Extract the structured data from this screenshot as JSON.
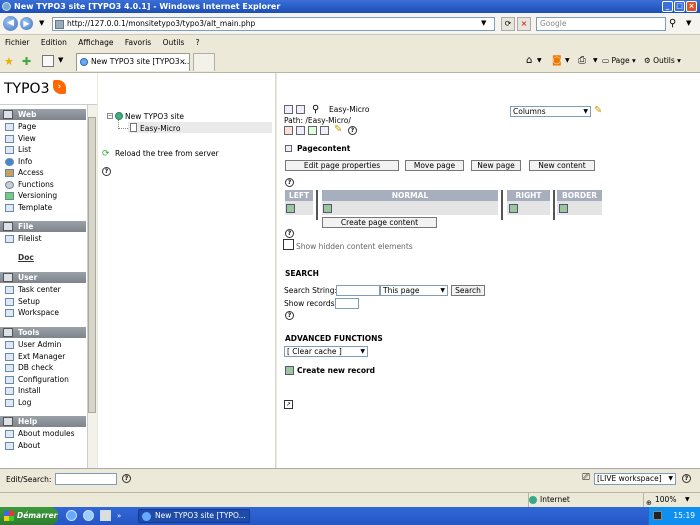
{
  "window": {
    "title": "New TYPO3 site [TYPO3 4.0.1] - Windows Internet Explorer"
  },
  "address": {
    "url": "http://127.0.0.1/monsitetypo3/typo3/alt_main.php",
    "search_placeholder": "Google"
  },
  "menu": [
    "Fichier",
    "Edition",
    "Affichage",
    "Favoris",
    "Outils",
    "?"
  ],
  "tabs": {
    "active": "New TYPO3 site [TYPO3 ..."
  },
  "toolbar": {
    "page": "Page",
    "tools": "Outils"
  },
  "logo": {
    "text": "TYPO3"
  },
  "nav": {
    "web": {
      "title": "Web",
      "items": [
        "Page",
        "View",
        "List",
        "Info",
        "Access",
        "Functions",
        "Versioning",
        "Template"
      ]
    },
    "file": {
      "title": "File",
      "items": [
        "Filelist"
      ]
    },
    "doc": {
      "title": "Doc"
    },
    "user": {
      "title": "User",
      "items": [
        "Task center",
        "Setup",
        "Workspace"
      ]
    },
    "tools": {
      "title": "Tools",
      "items": [
        "User Admin",
        "Ext Manager",
        "DB check",
        "Configuration",
        "Install",
        "Log"
      ]
    },
    "help": {
      "title": "Help",
      "items": [
        "About modules",
        "About"
      ]
    }
  },
  "tree": {
    "root": "New TYPO3 site",
    "child": "Easy-Micro",
    "reload": "Reload the tree from server"
  },
  "page": {
    "name": "Easy-Micro",
    "path": "Path: /Easy-Micro/",
    "columns_select": "Columns",
    "section": "Pagecontent",
    "buttons": {
      "edit": "Edit page properties",
      "move": "Move page",
      "new_page": "New page",
      "new_content": "New content"
    },
    "columns": [
      "LEFT",
      "NORMAL",
      "RIGHT",
      "BORDER"
    ],
    "create_content": "Create page content",
    "show_hidden": "Show hidden content elements",
    "search": {
      "title": "SEARCH",
      "string_label": "Search String:",
      "scope": "This page",
      "button": "Search",
      "records_label": "Show records:"
    },
    "advanced": {
      "title": "ADVANCED FUNCTIONS",
      "clear_cache": "[ Clear cache ]",
      "new_record": "Create new record"
    }
  },
  "bottom": {
    "edit_search": "Edit/Search:",
    "workspace": "[LIVE workspace]"
  },
  "status": {
    "zone": "Internet",
    "zoom": "100%"
  },
  "taskbar": {
    "start": "Démarrer",
    "task": "New TYPO3 site [TYPO...",
    "clock": "15:19"
  }
}
